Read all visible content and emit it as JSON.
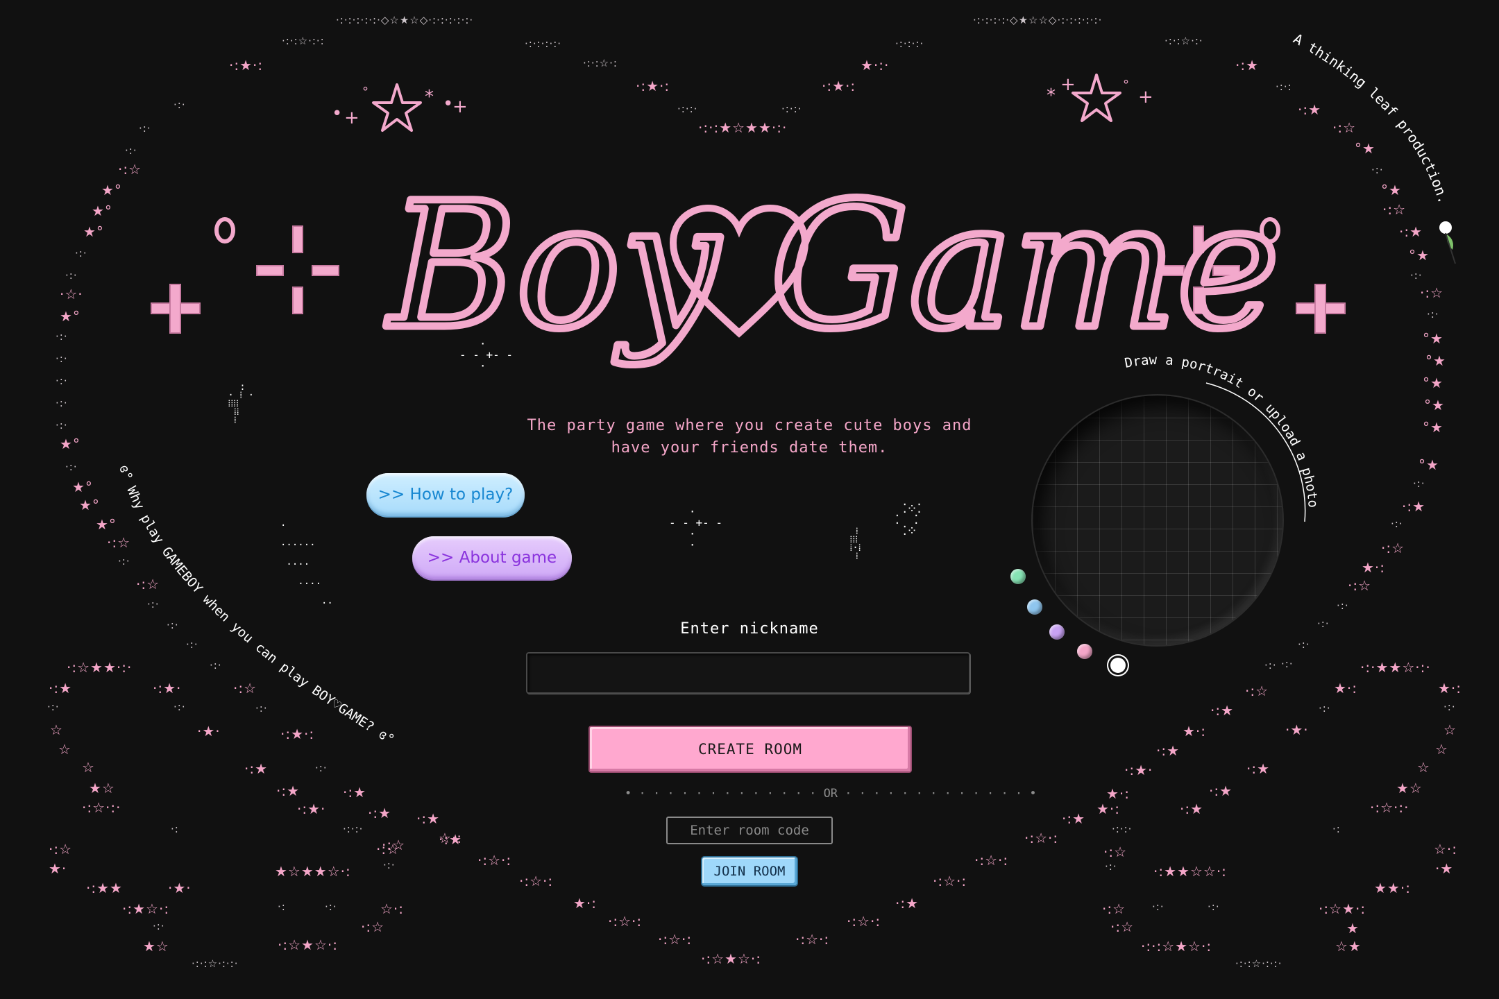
{
  "app": {
    "title": "Boy Game",
    "subtitle_line1": "The party game where you create cute boys and",
    "subtitle_line2": "have your friends date them."
  },
  "credit": {
    "text": "A thinking leaf production.",
    "icon": "leaf-icon"
  },
  "left_curve_text": "ɞ° Why play GAMEBOY when you can play BOY♡GAME? ɞ°",
  "draw_hint": "Draw a portrait or upload a photo",
  "buttons": {
    "how_to_play": ">> How to play?",
    "about_game": ">> About game",
    "create_room": "CREATE ROOM",
    "join_room": "JOIN ROOM"
  },
  "nickname": {
    "label": "Enter nickname",
    "value": "",
    "placeholder": ""
  },
  "or_divider": "• · · · · · · · · · · · · · OR · · · · · · · · · · · · · •",
  "room_code": {
    "placeholder": "Enter room code",
    "value": ""
  },
  "palette": {
    "colors": [
      "#86e3b4",
      "#8fc6ef",
      "#c8a2f3",
      "#f4a6c8",
      "#ffffff"
    ],
    "selected_index": 4
  },
  "theme": {
    "background": "#111111",
    "accent_pink": "#f4a6c8",
    "accent_blue": "#a7dbfb",
    "accent_purple": "#cfa9f7"
  }
}
